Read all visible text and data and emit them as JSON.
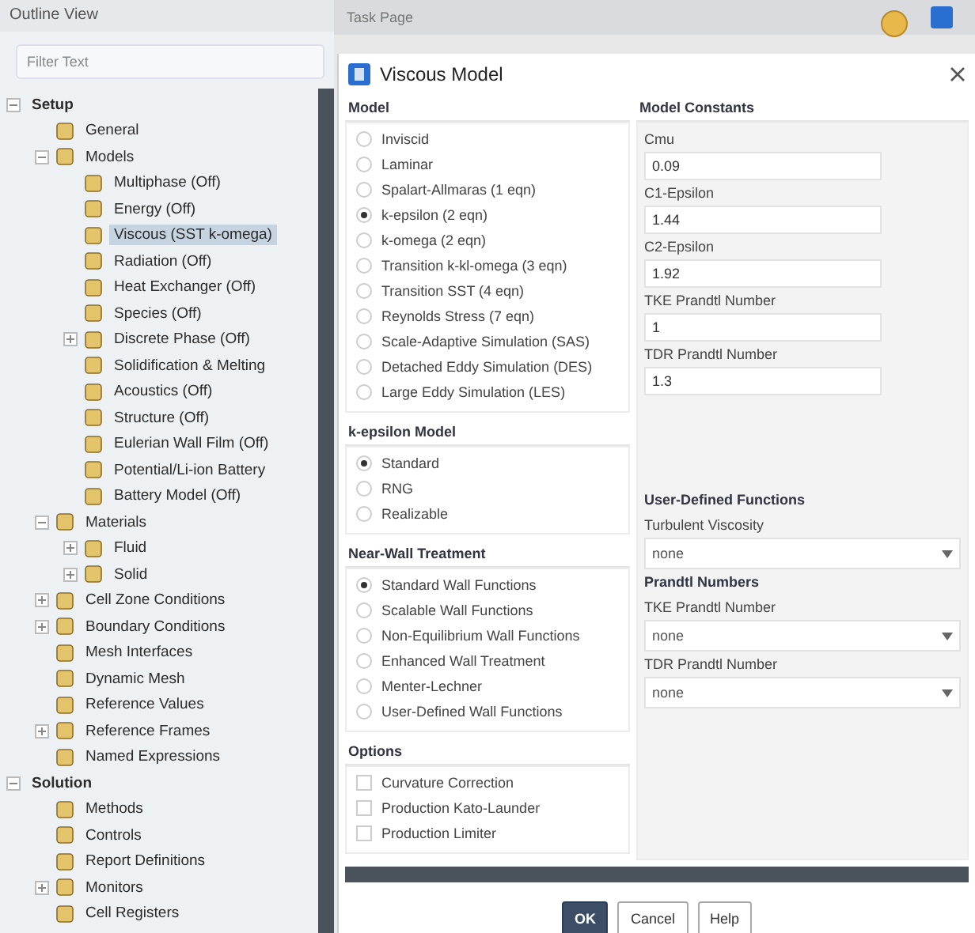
{
  "outline": {
    "title": "Outline View",
    "filter": {
      "placeholder": "Filter Text"
    },
    "tree": [
      {
        "label": "Setup",
        "bold": true,
        "expanded": true,
        "selected": false,
        "children": [
          {
            "label": "General",
            "selected": false
          },
          {
            "label": "Models",
            "expanded": true,
            "selected": false,
            "children": [
              {
                "label": "Multiphase (Off)",
                "selected": false
              },
              {
                "label": "Energy (Off)",
                "selected": false
              },
              {
                "label": "Viscous (SST k-omega)",
                "selected": true
              },
              {
                "label": "Radiation (Off)",
                "selected": false
              },
              {
                "label": "Heat Exchanger (Off)",
                "selected": false
              },
              {
                "label": "Species (Off)",
                "selected": false
              },
              {
                "label": "Discrete Phase (Off)",
                "expanded": false,
                "selected": false
              },
              {
                "label": "Solidification & Melting",
                "selected": false
              },
              {
                "label": "Acoustics (Off)",
                "selected": false
              },
              {
                "label": "Structure (Off)",
                "selected": false
              },
              {
                "label": "Eulerian Wall Film (Off)",
                "selected": false
              },
              {
                "label": "Potential/Li-ion Battery",
                "selected": false
              },
              {
                "label": "Battery Model (Off)",
                "selected": false
              }
            ]
          },
          {
            "label": "Materials",
            "expanded": true,
            "selected": false,
            "children": [
              {
                "label": "Fluid",
                "expanded": false,
                "selected": false
              },
              {
                "label": "Solid",
                "expanded": false,
                "selected": false
              }
            ]
          },
          {
            "label": "Cell Zone Conditions",
            "expanded": false,
            "selected": false
          },
          {
            "label": "Boundary Conditions",
            "expanded": false,
            "selected": false
          },
          {
            "label": "Mesh Interfaces",
            "selected": false
          },
          {
            "label": "Dynamic Mesh",
            "selected": false
          },
          {
            "label": "Reference Values",
            "selected": false
          },
          {
            "label": "Reference Frames",
            "expanded": false,
            "selected": false
          },
          {
            "label": "Named Expressions",
            "selected": false
          }
        ]
      },
      {
        "label": "Solution",
        "bold": true,
        "expanded": true,
        "selected": false,
        "children": [
          {
            "label": "Methods",
            "selected": false
          },
          {
            "label": "Controls",
            "selected": false
          },
          {
            "label": "Report Definitions",
            "selected": false
          },
          {
            "label": "Monitors",
            "expanded": false,
            "selected": false
          },
          {
            "label": "Cell Registers",
            "selected": false
          }
        ]
      }
    ]
  },
  "task_page": {
    "title": "Task Page"
  },
  "dialog": {
    "title": "Viscous Model",
    "model": {
      "title": "Model",
      "options": [
        {
          "label": "Inviscid",
          "selected": false
        },
        {
          "label": "Laminar",
          "selected": false
        },
        {
          "label": "Spalart-Allmaras (1 eqn)",
          "selected": false
        },
        {
          "label": "k-epsilon (2 eqn)",
          "selected": true
        },
        {
          "label": "k-omega (2 eqn)",
          "selected": false
        },
        {
          "label": "Transition k-kl-omega (3 eqn)",
          "selected": false
        },
        {
          "label": "Transition SST (4 eqn)",
          "selected": false
        },
        {
          "label": "Reynolds Stress (7 eqn)",
          "selected": false
        },
        {
          "label": "Scale-Adaptive Simulation (SAS)",
          "selected": false
        },
        {
          "label": "Detached Eddy Simulation (DES)",
          "selected": false
        },
        {
          "label": "Large Eddy Simulation (LES)",
          "selected": false
        }
      ]
    },
    "k_epsilon_model": {
      "title": "k-epsilon Model",
      "options": [
        {
          "label": "Standard",
          "selected": true
        },
        {
          "label": "RNG",
          "selected": false
        },
        {
          "label": "Realizable",
          "selected": false
        }
      ]
    },
    "near_wall_treatment": {
      "title": "Near-Wall Treatment",
      "options": [
        {
          "label": "Standard Wall Functions",
          "selected": true
        },
        {
          "label": "Scalable Wall Functions",
          "selected": false
        },
        {
          "label": "Non-Equilibrium Wall Functions",
          "selected": false
        },
        {
          "label": "Enhanced Wall Treatment",
          "selected": false
        },
        {
          "label": "Menter-Lechner",
          "selected": false
        },
        {
          "label": "User-Defined Wall Functions",
          "selected": false
        }
      ]
    },
    "options": {
      "title": "Options",
      "items": [
        {
          "label": "Curvature Correction",
          "checked": false
        },
        {
          "label": "Production Kato-Launder",
          "checked": false
        },
        {
          "label": "Production Limiter",
          "checked": false
        }
      ]
    },
    "model_constants": {
      "title": "Model Constants",
      "fields": [
        {
          "label": "Cmu",
          "value": "0.09"
        },
        {
          "label": "C1-Epsilon",
          "value": "1.44"
        },
        {
          "label": "C2-Epsilon",
          "value": "1.92"
        },
        {
          "label": "TKE Prandtl Number",
          "value": "1"
        },
        {
          "label": "TDR Prandtl Number",
          "value": "1.3"
        }
      ]
    },
    "user_defined_functions": {
      "title": "User-Defined Functions",
      "turbulent_viscosity": {
        "label": "Turbulent Viscosity",
        "value": "none"
      },
      "prandtl_numbers": {
        "title": "Prandtl Numbers",
        "fields": [
          {
            "label": "TKE Prandtl Number",
            "value": "none"
          },
          {
            "label": "TDR Prandtl Number",
            "value": "none"
          }
        ]
      }
    },
    "buttons": [
      {
        "label": "OK",
        "kind": "primary"
      },
      {
        "label": "Cancel",
        "kind": "normal"
      },
      {
        "label": "Help",
        "kind": "normal"
      }
    ]
  }
}
